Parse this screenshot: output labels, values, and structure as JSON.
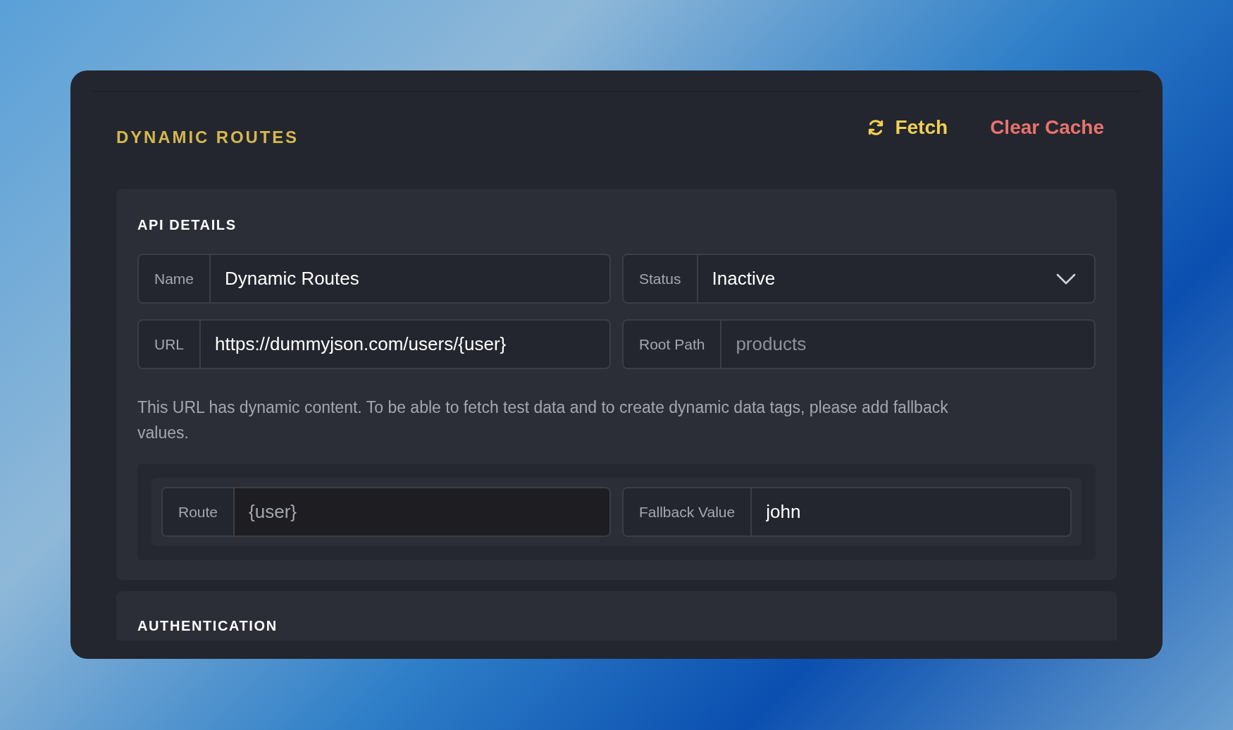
{
  "header": {
    "title": "DYNAMIC ROUTES",
    "actions": [
      {
        "kind": "fetch",
        "label": "Fetch"
      },
      {
        "kind": "clear",
        "label": "Clear Cache"
      }
    ]
  },
  "api_details": {
    "heading": "API DETAILS",
    "fields": [
      {
        "kind": "text",
        "label": "Name",
        "value": "Dynamic Routes"
      },
      {
        "kind": "select",
        "label": "Status",
        "value": "Inactive"
      },
      {
        "kind": "text",
        "label": "URL",
        "value": "https://dummyjson.com/users/{user}"
      },
      {
        "kind": "text",
        "label": "Root Path",
        "placeholder": "products"
      }
    ],
    "notice": "This URL has dynamic content. To be able to fetch test data and to create dynamic data tags, please add fallback values.",
    "fallbacks": [
      {
        "label": "Route",
        "value": "{user}",
        "disabled": true
      },
      {
        "label": "Fallback Value",
        "value": "john",
        "disabled": false
      }
    ]
  },
  "authentication": {
    "heading": "AUTHENTICATION"
  }
}
